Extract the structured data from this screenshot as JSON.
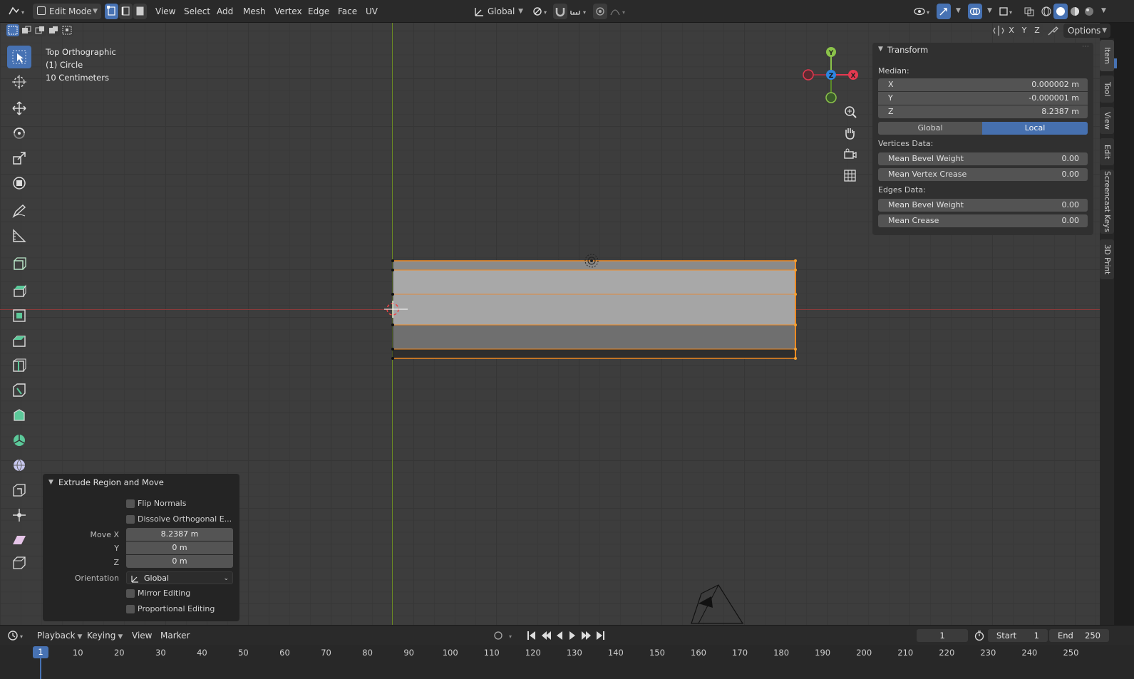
{
  "header": {
    "mode": "Edit Mode",
    "menus": [
      "View",
      "Select",
      "Add",
      "Mesh",
      "Vertex",
      "Edge",
      "Face",
      "UV"
    ],
    "orientation": "Global",
    "options": "Options",
    "axis_lock": [
      "X",
      "Y",
      "Z"
    ]
  },
  "viewport": {
    "view_name": "Top Orthographic",
    "object": "(1) Circle",
    "scale": "10 Centimeters"
  },
  "gizmo": {
    "x": "X",
    "y": "Y",
    "z": "Z"
  },
  "npanel": {
    "title": "Transform",
    "median_label": "Median:",
    "x_label": "X",
    "x_value": "0.000002 m",
    "y_label": "Y",
    "y_value": "-0.000001 m",
    "z_label": "Z",
    "z_value": "8.2387 m",
    "space_global": "Global",
    "space_local": "Local",
    "vertices_data": "Vertices Data:",
    "mean_bevel_weight_v": "Mean Bevel Weight",
    "mean_bevel_weight_v_val": "0.00",
    "mean_vertex_crease": "Mean Vertex Crease",
    "mean_vertex_crease_val": "0.00",
    "edges_data": "Edges Data:",
    "mean_bevel_weight_e": "Mean Bevel Weight",
    "mean_bevel_weight_e_val": "0.00",
    "mean_crease": "Mean Crease",
    "mean_crease_val": "0.00"
  },
  "side_tabs": [
    "Item",
    "Tool",
    "View",
    "Edit",
    "Screencast Keys",
    "3D Print"
  ],
  "operator": {
    "title": "Extrude Region and Move",
    "flip_normals": "Flip Normals",
    "dissolve": "Dissolve Orthogonal E...",
    "move_x_label": "Move X",
    "move_x": "8.2387 m",
    "y_label": "Y",
    "move_y": "0 m",
    "z_label": "Z",
    "move_z": "0 m",
    "orientation_label": "Orientation",
    "orientation": "Global",
    "mirror": "Mirror Editing",
    "proportional": "Proportional Editing"
  },
  "timeline": {
    "menus": [
      "Playback",
      "Keying",
      "View",
      "Marker"
    ],
    "current_frame": "1",
    "start_label": "Start",
    "start": "1",
    "end_label": "End",
    "end": "250",
    "frame_marker": "1",
    "ruler": [
      "10",
      "20",
      "30",
      "40",
      "50",
      "60",
      "70",
      "80",
      "90",
      "100",
      "110",
      "120",
      "130",
      "140",
      "150",
      "160",
      "170",
      "180",
      "190",
      "200",
      "210",
      "220",
      "230",
      "240",
      "250"
    ]
  }
}
